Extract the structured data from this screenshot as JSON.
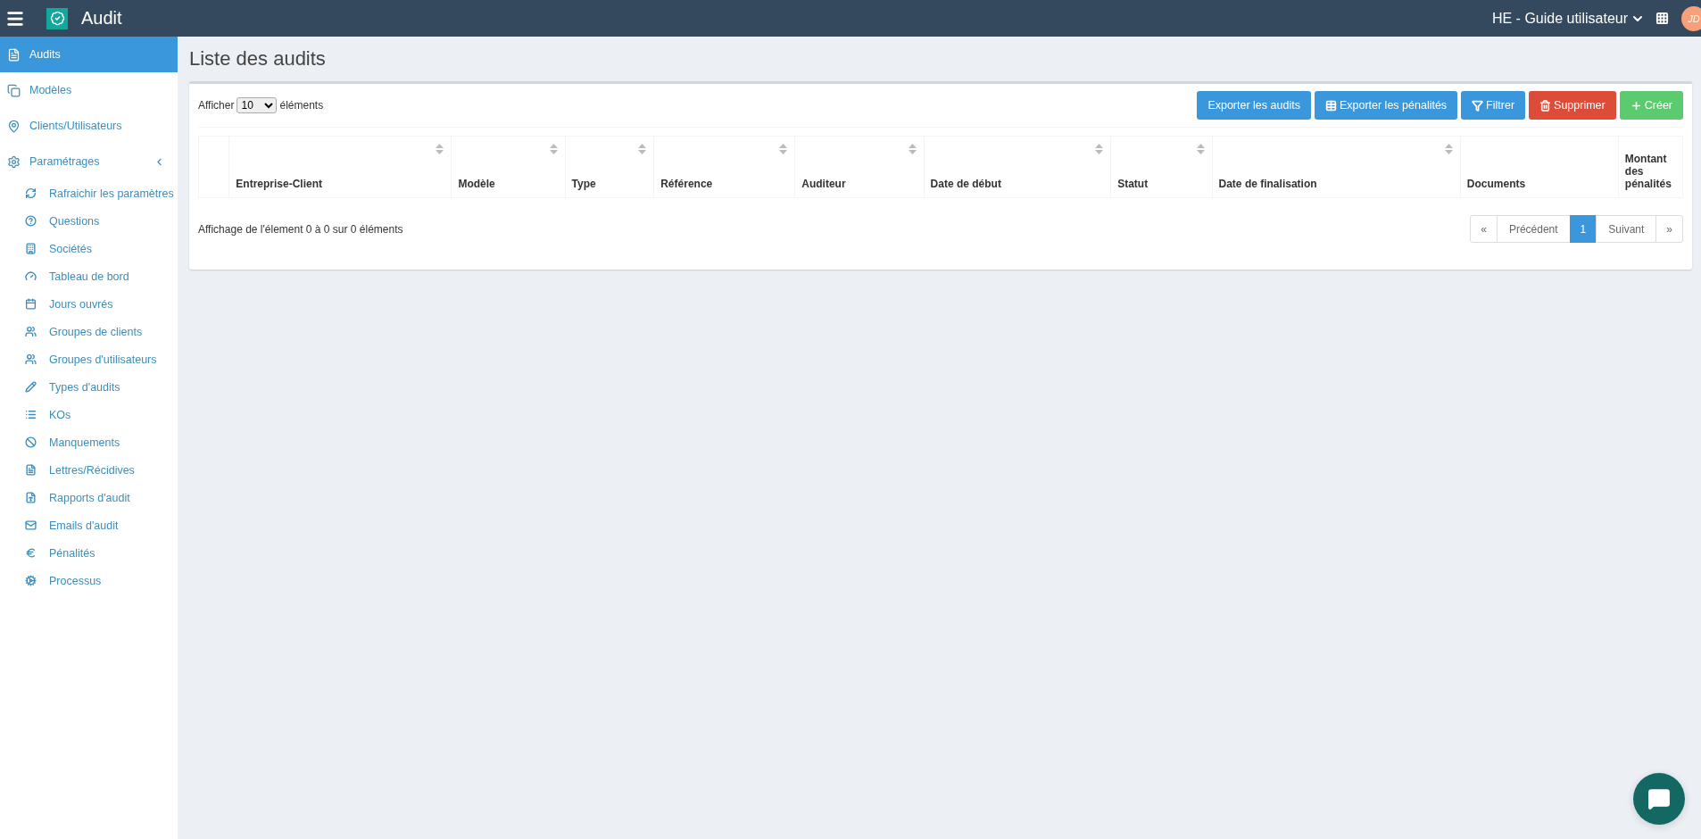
{
  "header": {
    "app_name": "Audit",
    "guide": "HE - Guide utilisateur",
    "avatar": "JD"
  },
  "sidebar": {
    "items": [
      {
        "label": "Audits",
        "selected": true
      },
      {
        "label": "Modèles",
        "selected": false
      },
      {
        "label": "Clients/Utilisateurs",
        "selected": false
      },
      {
        "label": "Paramétrages",
        "selected": false,
        "expanded": true,
        "children": [
          {
            "label": "Rafraichir les paramètres"
          },
          {
            "label": "Questions"
          },
          {
            "label": "Sociétés"
          },
          {
            "label": "Tableau de bord"
          },
          {
            "label": "Jours ouvrés"
          },
          {
            "label": "Groupes de clients"
          },
          {
            "label": "Groupes d'utilisateurs"
          },
          {
            "label": "Types d'audits"
          },
          {
            "label": "KOs"
          },
          {
            "label": "Manquements"
          },
          {
            "label": "Lettres/Récidives"
          },
          {
            "label": "Rapports d'audit"
          },
          {
            "label": "Emails d'audit"
          },
          {
            "label": "Pénalités"
          },
          {
            "label": "Processus"
          }
        ]
      }
    ]
  },
  "page": {
    "title": "Liste des audits",
    "length": {
      "before": "Afficher",
      "value": "10",
      "after": "éléments"
    },
    "buttons": [
      {
        "label": "Exporter les audits",
        "kind": "primary"
      },
      {
        "label": "Exporter les pénalités",
        "kind": "primary"
      },
      {
        "label": "Filtrer",
        "kind": "primary"
      },
      {
        "label": "Supprimer",
        "kind": "danger"
      },
      {
        "label": "Créer",
        "kind": "success"
      }
    ],
    "table": {
      "columns": [
        {
          "sortable": false
        },
        {
          "label": "Entreprise-Client",
          "sortable": true
        },
        {
          "label": "Modèle",
          "sortable": true
        },
        {
          "label": "Type",
          "sortable": true
        },
        {
          "label": "Référence",
          "sortable": true
        },
        {
          "label": "Auditeur",
          "sortable": true
        },
        {
          "label": "Date de début",
          "sortable": true
        },
        {
          "label": "Statut",
          "sortable": true
        },
        {
          "label": "Date de finalisation",
          "sortable": true
        },
        {
          "label": "Documents",
          "sortable": false
        },
        {
          "label": "Montant des pénalités",
          "sortable": false
        }
      ]
    },
    "info": "Affichage de l'élement 0 à 0 sur 0 éléments",
    "pagination": [
      {
        "label": "«",
        "selected": false
      },
      {
        "label": "Précédent",
        "selected": false
      },
      {
        "label": "1",
        "selected": true
      },
      {
        "label": "Suivant",
        "selected": false
      },
      {
        "label": "»",
        "selected": false
      }
    ]
  }
}
